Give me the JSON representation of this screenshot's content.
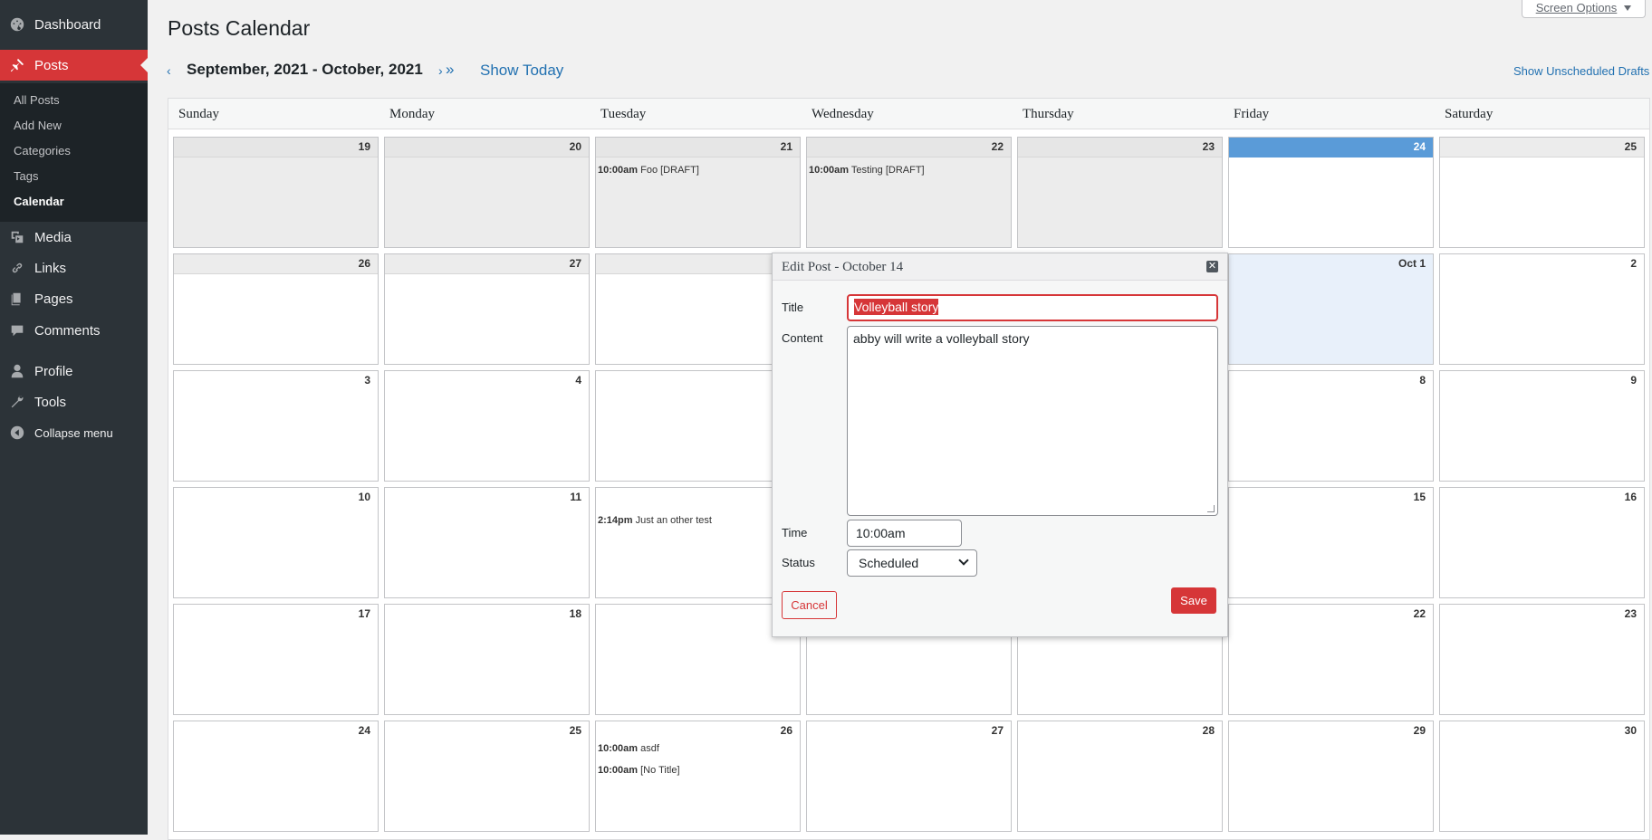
{
  "sidebar": {
    "dashboard": "Dashboard",
    "posts": "Posts",
    "submenu": [
      "All Posts",
      "Add New",
      "Categories",
      "Tags",
      "Calendar"
    ],
    "media": "Media",
    "links": "Links",
    "pages": "Pages",
    "comments": "Comments",
    "profile": "Profile",
    "tools": "Tools",
    "collapse": "Collapse menu"
  },
  "header": {
    "title": "Posts Calendar",
    "screen_options": "Screen Options"
  },
  "nav": {
    "prev": "‹",
    "range": "September, 2021 - October, 2021",
    "next": "›",
    "next_double": "»",
    "show_today": "Show Today",
    "show_unscheduled": "Show Unscheduled Drafts"
  },
  "calendar": {
    "days": [
      "Sunday",
      "Monday",
      "Tuesday",
      "Wednesday",
      "Thursday",
      "Friday",
      "Saturday"
    ],
    "weeks": [
      [
        "19",
        "20",
        "21",
        "22",
        "23",
        "24",
        "25"
      ],
      [
        "26",
        "27",
        "",
        "",
        "",
        "Oct 1",
        "2"
      ],
      [
        "3",
        "4",
        "",
        "",
        "",
        "8",
        "9"
      ],
      [
        "10",
        "11",
        "",
        "",
        "",
        "15",
        "16"
      ],
      [
        "17",
        "18",
        "",
        "",
        "",
        "22",
        "23"
      ],
      [
        "24",
        "25",
        "26",
        "27",
        "28",
        "29",
        "30"
      ]
    ],
    "posts": {
      "w0_tue": {
        "time": "10:00am",
        "title": "Foo [DRAFT]"
      },
      "w0_wed": {
        "time": "10:00am",
        "title": "Testing [DRAFT]"
      },
      "w3_tue": {
        "time": "2:14pm",
        "title": "Just an other test"
      },
      "w5_tue_1": {
        "time": "10:00am",
        "title": "asdf"
      },
      "w5_tue_2": {
        "time": "10:00am",
        "title": "[No Title]"
      }
    }
  },
  "popup": {
    "title": "Edit Post - October 14",
    "close": "✕",
    "title_label": "Title",
    "title_value": "Volleyball story",
    "content_label": "Content",
    "content_value": "abby will write a volleyball story",
    "time_label": "Time",
    "time_value": "10:00am",
    "status_label": "Status",
    "status_value": "Scheduled",
    "cancel": "Cancel",
    "save": "Save"
  },
  "colors": {
    "accent": "#d63638",
    "link": "#2271b1",
    "sidebar": "#2c3338",
    "today": "#5a9bd8"
  }
}
